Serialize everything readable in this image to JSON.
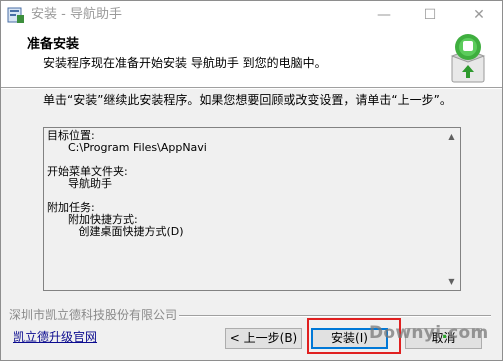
{
  "window": {
    "title": "安装 - 导航助手",
    "controls": {
      "minimize": "—",
      "maximize": "☐",
      "close": "✕"
    }
  },
  "header": {
    "title": "准备安装",
    "subtitle": "安装程序现在准备开始安装 导航助手 到您的电脑中。",
    "logo_icon": "installer-logo-icon"
  },
  "intro_text": "单击“安装”继续此安装程序。如果您想要回顾或改变设置，请单击“上一步”。",
  "summary": {
    "lines": [
      "目标位置:",
      "      C:\\Program Files\\AppNavi",
      "",
      "开始菜单文件夹:",
      "      导航助手",
      "",
      "附加任务:",
      "      附加快捷方式:",
      "         创建桌面快捷方式(D)"
    ]
  },
  "footer": {
    "company": "深圳市凯立德科技股份有限公司",
    "upgrade_link": "凯立德升级官网"
  },
  "buttons": {
    "back": "< 上一步(B)",
    "install": "安装(I)",
    "cancel": "取消"
  },
  "watermark": {
    "prefix": "D",
    "text": "ownyi",
    "suffix": "com"
  },
  "colors": {
    "highlight": "#e02020",
    "link": "#0b0b8f",
    "focus": "#0078d7"
  }
}
